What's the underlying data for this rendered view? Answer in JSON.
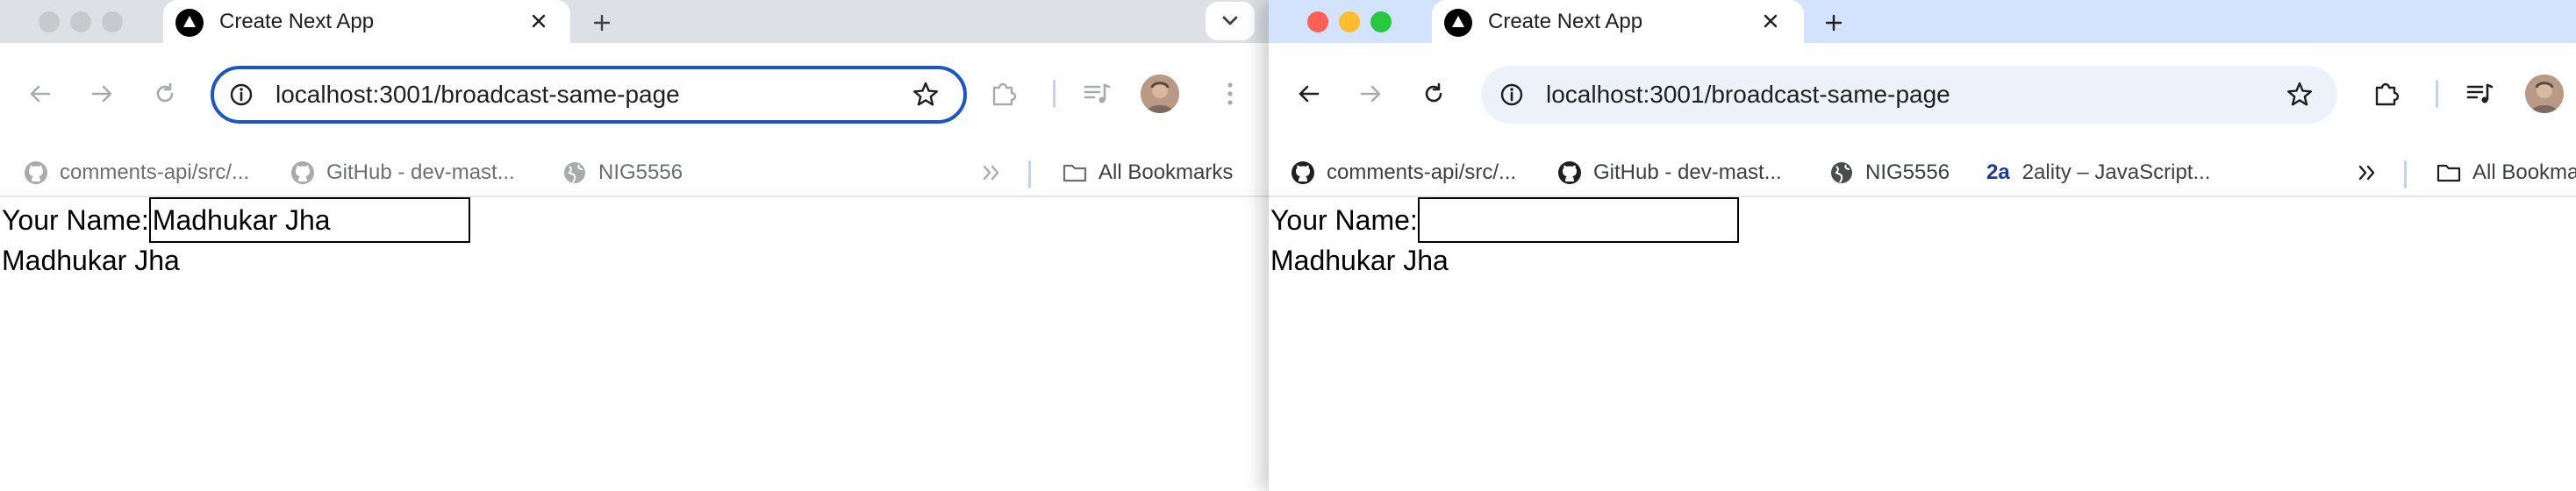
{
  "windows": [
    {
      "id": "left",
      "tab": {
        "title": "Create Next App"
      },
      "url": "localhost:3001/broadcast-same-page",
      "bookmarks": [
        {
          "label": "comments-api/src/...",
          "icon": "github-icon"
        },
        {
          "label": "GitHub - dev-mast...",
          "icon": "github-icon"
        },
        {
          "label": "NIG5556",
          "icon": "globe-icon"
        }
      ],
      "all_bookmarks_label": "All Bookmarks",
      "page": {
        "label": "Your Name:",
        "input_value": "Madhukar Jha",
        "echo_text": "Madhukar Jha"
      }
    },
    {
      "id": "right",
      "tab": {
        "title": "Create Next App"
      },
      "url": "localhost:3001/broadcast-same-page",
      "bookmarks": [
        {
          "label": "comments-api/src/...",
          "icon": "github-icon"
        },
        {
          "label": "GitHub - dev-mast...",
          "icon": "github-icon"
        },
        {
          "label": "NIG5556",
          "icon": "globe-icon"
        },
        {
          "label": "2ality – JavaScript...",
          "icon": "2ality-icon",
          "icon_text": "2a"
        }
      ],
      "all_bookmarks_label": "All Bookmarks",
      "page": {
        "label": "Your Name:",
        "input_value": "",
        "echo_text": "Madhukar Jha"
      }
    }
  ],
  "colors": {
    "left_tabstrip": "#dde1e6",
    "right_tabstrip": "#d3e3fd",
    "focus_ring": "#1a56c8",
    "omnibox_bg_unfocused": "#edf2fa",
    "close_red": "#ff5f57",
    "minimize_yellow": "#febc2e",
    "zoom_green": "#28c840"
  }
}
